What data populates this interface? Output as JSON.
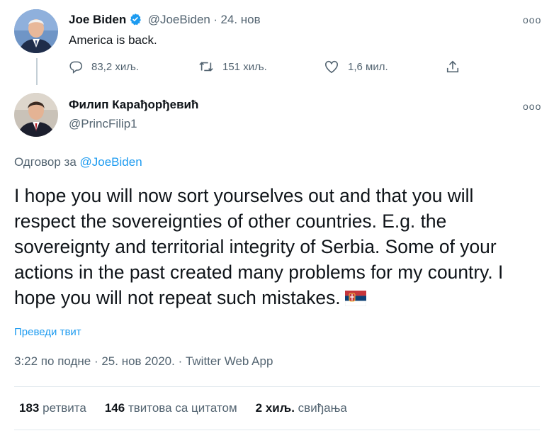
{
  "parent_tweet": {
    "author_name": "Joe Biden",
    "handle": "@JoeBiden",
    "separator": "·",
    "date": "24. нов",
    "text": "America is back.",
    "more_label": "ooo",
    "replies": "83,2 хиљ.",
    "retweets": "151 хиљ.",
    "likes": "1,6 мил."
  },
  "reply_tweet": {
    "author_name": "Филип Карађорђевић",
    "handle": "@PrincFilip1",
    "more_label": "ooo",
    "replying_to_prefix": "Одговор за",
    "replying_to_handle": "@JoeBiden",
    "text": "I hope you will now sort yourselves out and that you will respect the sovereignties of other countries. E.g. the sovereignty and territorial integrity of Serbia. Some of your actions in the past created many problems for my country. I hope you will not repeat such mistakes.",
    "translate_label": "Преведи твит",
    "timestamp": "3:22 по подне · 25. нов 2020. · Twitter Web App",
    "stats": {
      "retweets_count": "183",
      "retweets_label": "ретвита",
      "quotes_count": "146",
      "quotes_label": "твитова са цитатом",
      "likes_count": "2 хиљ.",
      "likes_label": "свиђања"
    }
  },
  "colors": {
    "link": "#1d9bf0",
    "secondary_text": "#536471",
    "verified_badge": "#1d9bf0"
  }
}
